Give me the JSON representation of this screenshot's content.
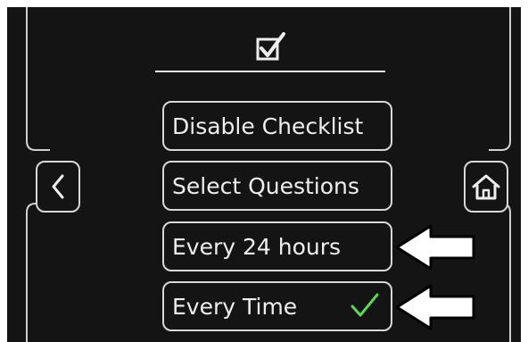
{
  "header": {
    "icon": "checkbox-checked-icon"
  },
  "nav": {
    "back_icon": "chevron-left-icon",
    "home_icon": "home-icon"
  },
  "menu": {
    "items": [
      {
        "label": "Disable Checklist",
        "selected": false
      },
      {
        "label": "Select Questions",
        "selected": false
      },
      {
        "label": "Every 24 hours",
        "selected": false
      },
      {
        "label": "Every Time",
        "selected": true
      }
    ],
    "selected_indicator": "checkmark-icon"
  },
  "annotations": {
    "arrow_icon": "arrow-left-icon"
  },
  "colors": {
    "background": "#141414",
    "border": "#d8d8d8",
    "text": "#eeeeee",
    "check": "#5fd35a"
  }
}
